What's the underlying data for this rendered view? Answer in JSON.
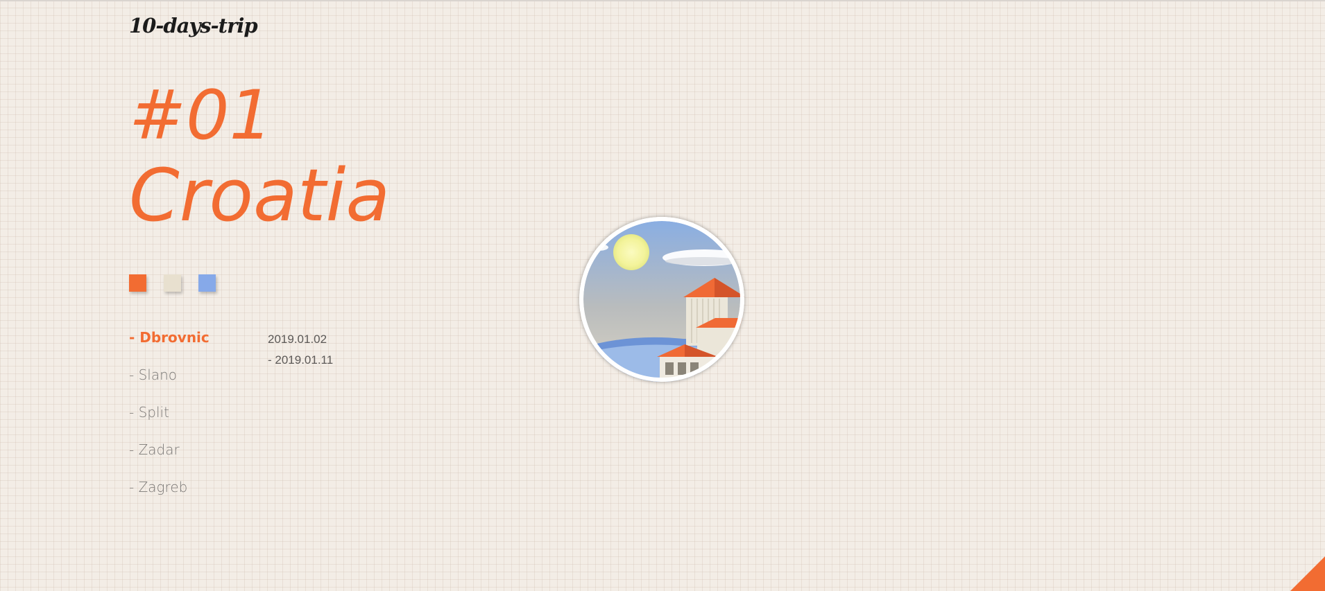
{
  "brand": {
    "logo": "10-days-trip"
  },
  "trip": {
    "number": "#01",
    "country": "Croatia"
  },
  "palette": {
    "colors": [
      "#f26c32",
      "#e8e0cf",
      "#86a9e9"
    ]
  },
  "cities": [
    {
      "label": "- Dbrovnic",
      "active": true
    },
    {
      "label": "- Slano",
      "active": false
    },
    {
      "label": "- Split",
      "active": false
    },
    {
      "label": "- Zadar",
      "active": false
    },
    {
      "label": "- Zagreb",
      "active": false
    }
  ],
  "dates": {
    "start": "2019.01.02",
    "end": "- 2019.01.11"
  },
  "colors": {
    "accent": "#f26c32",
    "background": "#f3ede6",
    "text_muted": "#7b7876"
  },
  "icons": {
    "corner": "corner-triangle-icon",
    "illustration": "city-illustration"
  }
}
